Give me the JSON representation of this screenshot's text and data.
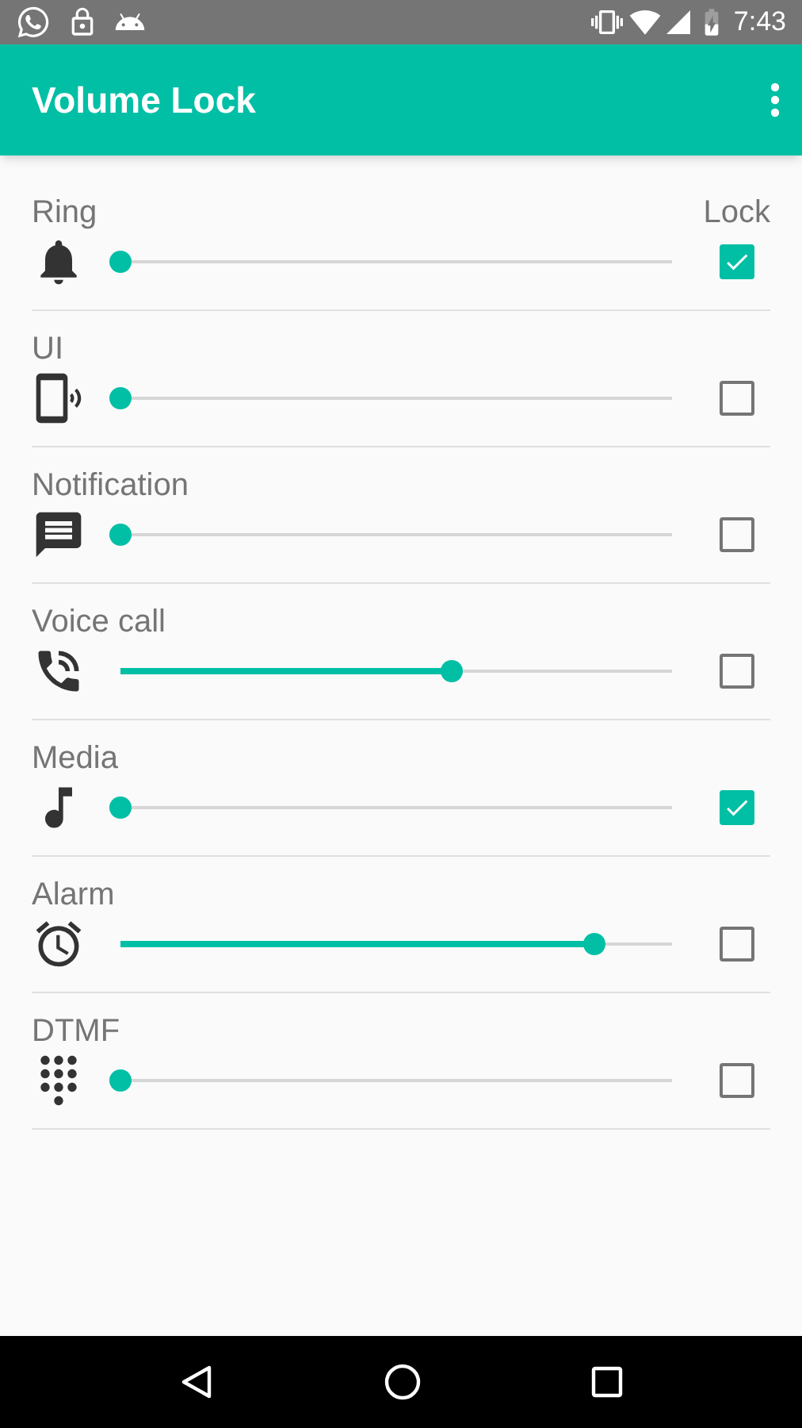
{
  "status_bar": {
    "time": "7:43"
  },
  "app_bar": {
    "title": "Volume Lock"
  },
  "lock_header": "Lock",
  "channels": [
    {
      "name": "Ring",
      "kind": "ring",
      "level": 0,
      "checked": true
    },
    {
      "name": "UI",
      "kind": "ui",
      "level": 0,
      "checked": false
    },
    {
      "name": "Notification",
      "kind": "notification",
      "level": 0,
      "checked": false
    },
    {
      "name": "Voice call",
      "kind": "voice",
      "level": 0.6,
      "checked": false
    },
    {
      "name": "Media",
      "kind": "media",
      "level": 0,
      "checked": true
    },
    {
      "name": "Alarm",
      "kind": "alarm",
      "level": 0.86,
      "checked": false
    },
    {
      "name": "DTMF",
      "kind": "dtmf",
      "level": 0,
      "checked": false
    }
  ]
}
